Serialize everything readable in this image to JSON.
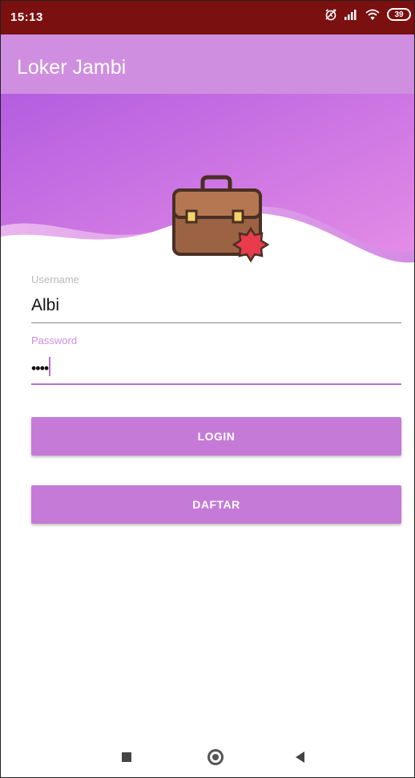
{
  "status_bar": {
    "time": "15:13",
    "battery": "39",
    "icons": [
      "alarm-icon",
      "signal-icon",
      "wifi-icon",
      "battery-icon"
    ]
  },
  "app_bar": {
    "title": "Loker Jambi"
  },
  "header": {
    "illustration": "briefcase-icon"
  },
  "form": {
    "username": {
      "label": "Username",
      "value": "Albi"
    },
    "password": {
      "label": "Password",
      "value": "••••"
    }
  },
  "buttons": {
    "login": "LOGIN",
    "register": "DAFTAR"
  },
  "nav_bar": {
    "icons": [
      "recent-apps-icon",
      "home-icon",
      "back-icon"
    ]
  },
  "colors": {
    "status_bar": "#7a1010",
    "app_bar": "#cf8ee0",
    "accent": "#c67ad8",
    "header_gradient_start": "#b45de0",
    "header_gradient_end": "#e68ee6"
  }
}
